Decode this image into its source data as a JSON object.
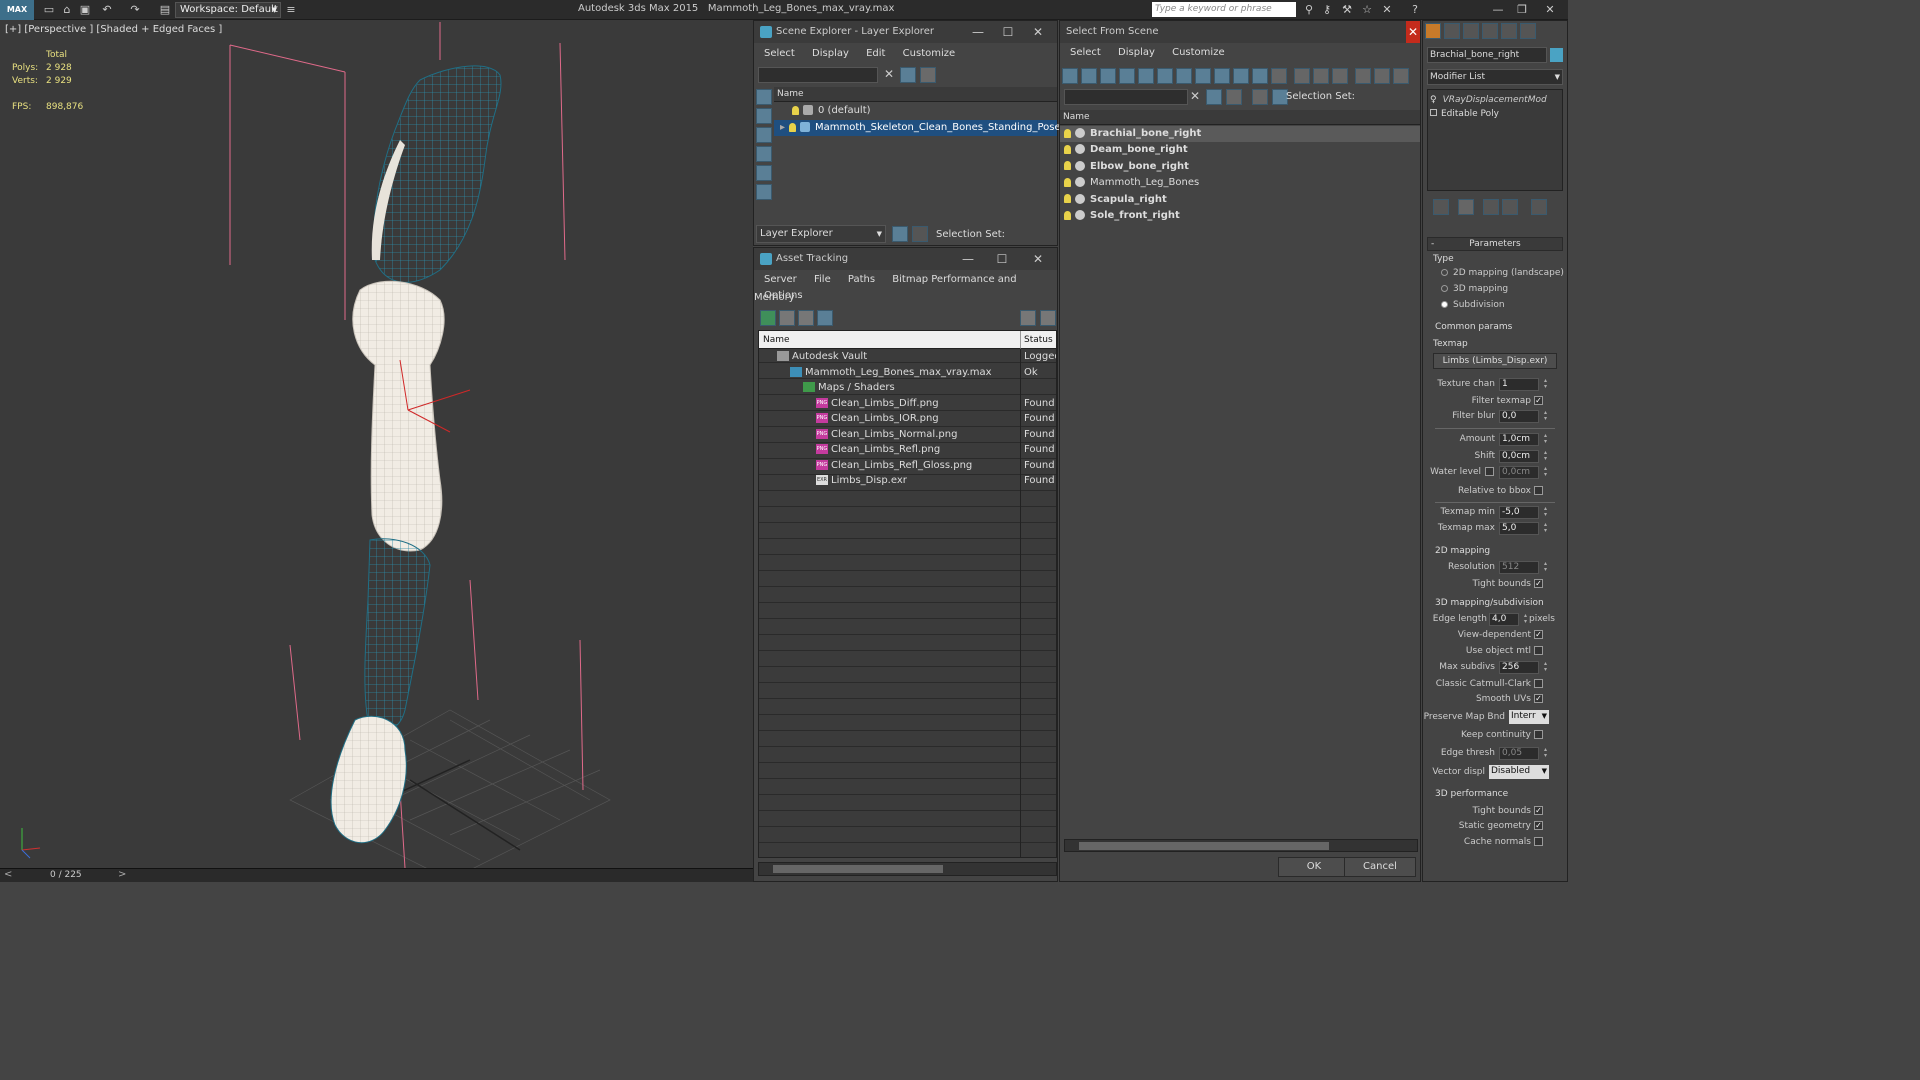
{
  "titlebar": {
    "logo": "MAX",
    "workspace_label": "Workspace: Default",
    "app_name": "Autodesk 3ds Max  2015",
    "file_name": "Mammoth_Leg_Bones_max_vray.max",
    "search_placeholder": "Type a keyword or phrase"
  },
  "viewport": {
    "label": "[+] [Perspective ] [Shaded + Edged Faces ]",
    "stats_header": "Total",
    "polys_label": "Polys:",
    "polys_value": "2 928",
    "verts_label": "Verts:",
    "verts_value": "2 929",
    "fps_label": "FPS:",
    "fps_value": "898,876"
  },
  "timeline": {
    "frame": "0 / 225"
  },
  "scene_explorer": {
    "title": "Scene Explorer - Layer Explorer",
    "menu": [
      "Select",
      "Display",
      "Edit",
      "Customize"
    ],
    "column_name": "Name",
    "layers": [
      "0 (default)",
      "Mammoth_Skeleton_Clean_Bones_Standing_Pose"
    ],
    "footer_label": "Layer Explorer",
    "selection_set_label": "Selection Set:"
  },
  "asset_tracking": {
    "title": "Asset Tracking",
    "menu": [
      "Server",
      "File",
      "Paths",
      "Bitmap Performance and Memory",
      "Options"
    ],
    "col_name": "Name",
    "col_status": "Status",
    "rows": [
      {
        "name": "Autodesk Vault",
        "status": "Logged",
        "indent": 0,
        "icon": "vault-icon"
      },
      {
        "name": "Mammoth_Leg_Bones_max_vray.max",
        "status": "Ok",
        "indent": 1,
        "icon": "max-file-icon"
      },
      {
        "name": "Maps / Shaders",
        "status": "",
        "indent": 2,
        "icon": "maps-icon"
      },
      {
        "name": "Clean_Limbs_Diff.png",
        "status": "Found",
        "indent": 3,
        "icon": "png-icon"
      },
      {
        "name": "Clean_Limbs_IOR.png",
        "status": "Found",
        "indent": 3,
        "icon": "png-icon"
      },
      {
        "name": "Clean_Limbs_Normal.png",
        "status": "Found",
        "indent": 3,
        "icon": "png-icon"
      },
      {
        "name": "Clean_Limbs_Refl.png",
        "status": "Found",
        "indent": 3,
        "icon": "png-icon"
      },
      {
        "name": "Clean_Limbs_Refl_Gloss.png",
        "status": "Found",
        "indent": 3,
        "icon": "png-icon"
      },
      {
        "name": "Limbs_Disp.exr",
        "status": "Found",
        "indent": 3,
        "icon": "exr-icon"
      }
    ]
  },
  "select_from_scene": {
    "title": "Select From Scene",
    "menu": [
      "Select",
      "Display",
      "Customize"
    ],
    "selection_set_label": "Selection Set:",
    "column_name": "Name",
    "objects": [
      {
        "name": "Brachial_bone_right",
        "bold": true
      },
      {
        "name": "Deam_bone_right",
        "bold": true
      },
      {
        "name": "Elbow_bone_right",
        "bold": true
      },
      {
        "name": "Mammoth_Leg_Bones",
        "bold": false
      },
      {
        "name": "Scapula_right",
        "bold": true
      },
      {
        "name": "Sole_front_right",
        "bold": true
      }
    ],
    "ok_label": "OK",
    "cancel_label": "Cancel"
  },
  "command_panel": {
    "object_name": "Brachial_bone_right",
    "modifier_list_label": "Modifier List",
    "stack": [
      "VRayDisplacementMod",
      "Editable Poly"
    ],
    "rollout_title": "Parameters",
    "type_label": "Type",
    "type_options": [
      "2D mapping (landscape)",
      "3D mapping",
      "Subdivision"
    ],
    "common_params_label": "Common params",
    "texmap_label": "Texmap",
    "texmap_value": "Limbs (Limbs_Disp.exr)",
    "texture_chan_label": "Texture chan",
    "texture_chan_value": "1",
    "filter_texmap_label": "Filter texmap",
    "filter_blur_label": "Filter blur",
    "filter_blur_value": "0,0",
    "amount_label": "Amount",
    "amount_value": "1,0cm",
    "shift_label": "Shift",
    "shift_value": "0,0cm",
    "water_level_label": "Water level",
    "water_level_value": "0,0cm",
    "relative_bbox_label": "Relative to bbox",
    "texmap_min_label": "Texmap min",
    "texmap_min_value": "-5,0",
    "texmap_max_label": "Texmap max",
    "texmap_max_value": "5,0",
    "mapping_2d_label": "2D mapping",
    "resolution_label": "Resolution",
    "resolution_value": "512",
    "tight_bounds_label": "Tight bounds",
    "mapping_3d_label": "3D mapping/subdivision",
    "edge_length_label": "Edge length",
    "edge_length_value": "4,0",
    "pixels_label": "pixels",
    "view_dependent_label": "View-dependent",
    "use_object_mtl_label": "Use object mtl",
    "max_subdivs_label": "Max subdivs",
    "max_subdivs_value": "256",
    "classic_cc_label": "Classic Catmull-Clark",
    "smooth_uvs_label": "Smooth UVs",
    "preserve_map_label": "Preserve Map Bnd",
    "preserve_map_value": "Interr",
    "keep_continuity_label": "Keep continuity",
    "edge_thresh_label": "Edge thresh",
    "edge_thresh_value": "0,05",
    "vector_displ_label": "Vector displ",
    "vector_displ_value": "Disabled",
    "perf_3d_label": "3D performance",
    "perf_tight_bounds_label": "Tight bounds",
    "static_geometry_label": "Static geometry",
    "cache_normals_label": "Cache normals"
  }
}
